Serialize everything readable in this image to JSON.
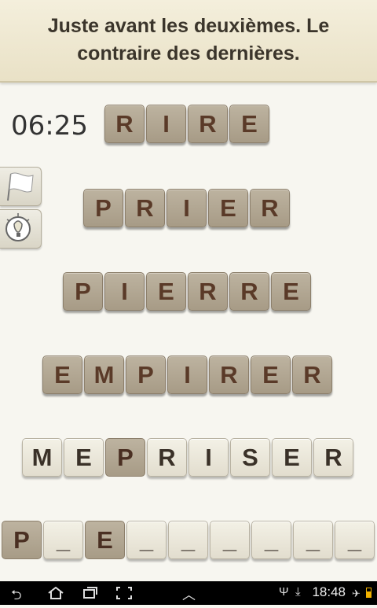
{
  "clue": {
    "line1": "Juste avant les deuxièmes. Le",
    "line2": "contraire des dernières."
  },
  "timer": "06:25",
  "rows": [
    [
      "R",
      "I",
      "R",
      "E"
    ],
    [
      "P",
      "R",
      "I",
      "E",
      "R"
    ],
    [
      "P",
      "I",
      "E",
      "R",
      "R",
      "E"
    ],
    [
      "E",
      "M",
      "P",
      "I",
      "R",
      "E",
      "R"
    ],
    [
      "M",
      "E",
      "P",
      "R",
      "I",
      "S",
      "E",
      "R"
    ],
    [
      "P",
      "_",
      "E",
      "_",
      "_",
      "_",
      "_",
      "_",
      "_"
    ]
  ],
  "side_buttons": [
    "flag-icon",
    "lightbulb-icon"
  ],
  "status_bar": {
    "time": "18:48",
    "icons": [
      "back-icon",
      "home-icon",
      "recent-apps-icon",
      "screenshot-icon",
      "up-chevron-icon",
      "usb-icon",
      "download-icon",
      "airplane-icon",
      "battery-icon"
    ]
  }
}
